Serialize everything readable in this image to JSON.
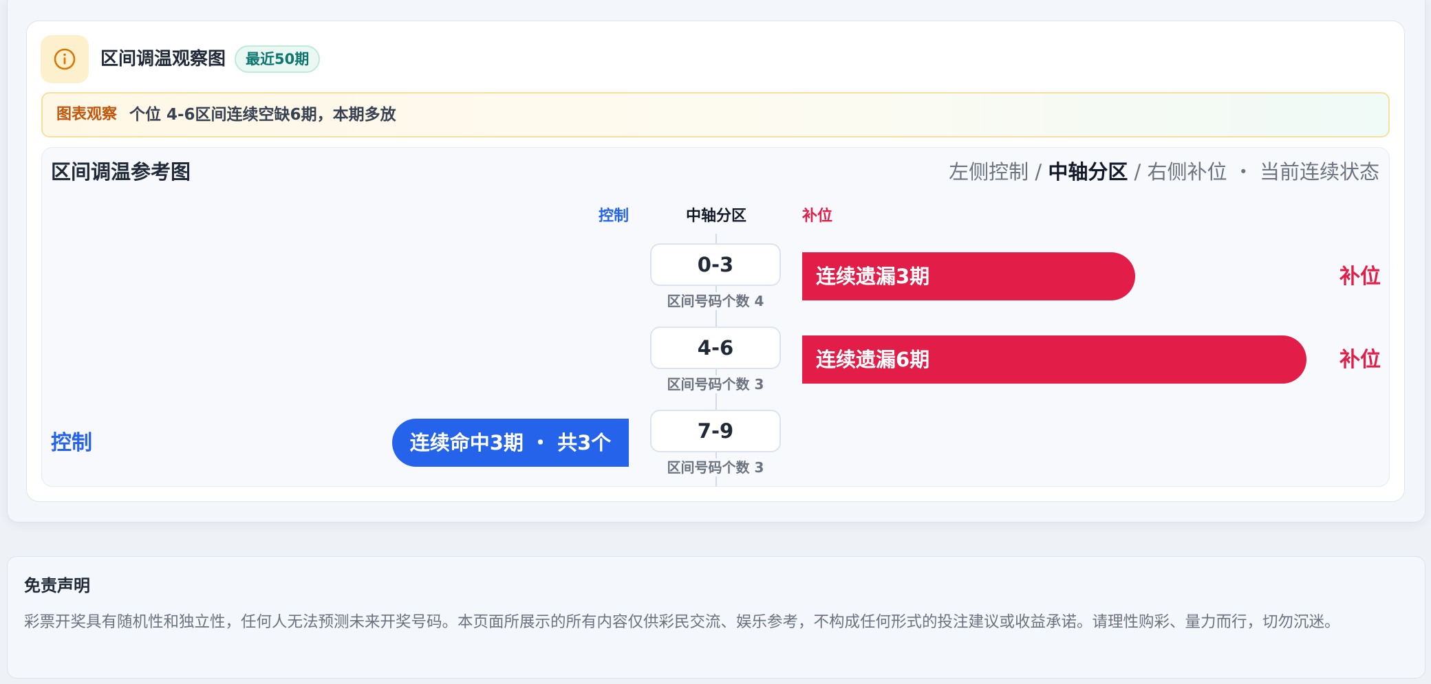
{
  "header": {
    "icon": "info-icon",
    "title": "区间调温观察图",
    "badge": "最近50期"
  },
  "observation": {
    "label": "图表观察",
    "text": "个位 4-6区间连续空缺6期，本期多放"
  },
  "panel": {
    "title": "区间调温参考图",
    "subtitle_left": "左侧控制 / ",
    "subtitle_bold": "中轴分区",
    "subtitle_right": " / 右侧补位 ・ 当前连续状态",
    "col_control": "控制",
    "col_axis": "中轴分区",
    "col_fill": "补位"
  },
  "zones": [
    {
      "range": "0-3",
      "count_label": "区间号码个数 4",
      "bar_text": "连续遗漏3期",
      "side_label": "补位",
      "direction": "right",
      "streak": 3
    },
    {
      "range": "4-6",
      "count_label": "区间号码个数 3",
      "bar_text": "连续遗漏6期",
      "side_label": "补位",
      "direction": "right",
      "streak": 6
    },
    {
      "range": "7-9",
      "count_label": "区间号码个数 3",
      "bar_text": "连续命中3期 ・ 共3个",
      "side_label": "控制",
      "direction": "left",
      "streak": 3
    }
  ],
  "colors": {
    "fill": "#e11d48",
    "control": "#2563eb",
    "accent_orange": "#c2570c",
    "badge_green": "#0f766e"
  },
  "disclaimer": {
    "title": "免责声明",
    "text": "彩票开奖具有随机性和独立性，任何人无法预测未来开奖号码。本页面所展示的所有内容仅供彩民交流、娱乐参考，不构成任何形式的投注建议或收益承诺。请理性购彩、量力而行，切勿沉迷。"
  }
}
